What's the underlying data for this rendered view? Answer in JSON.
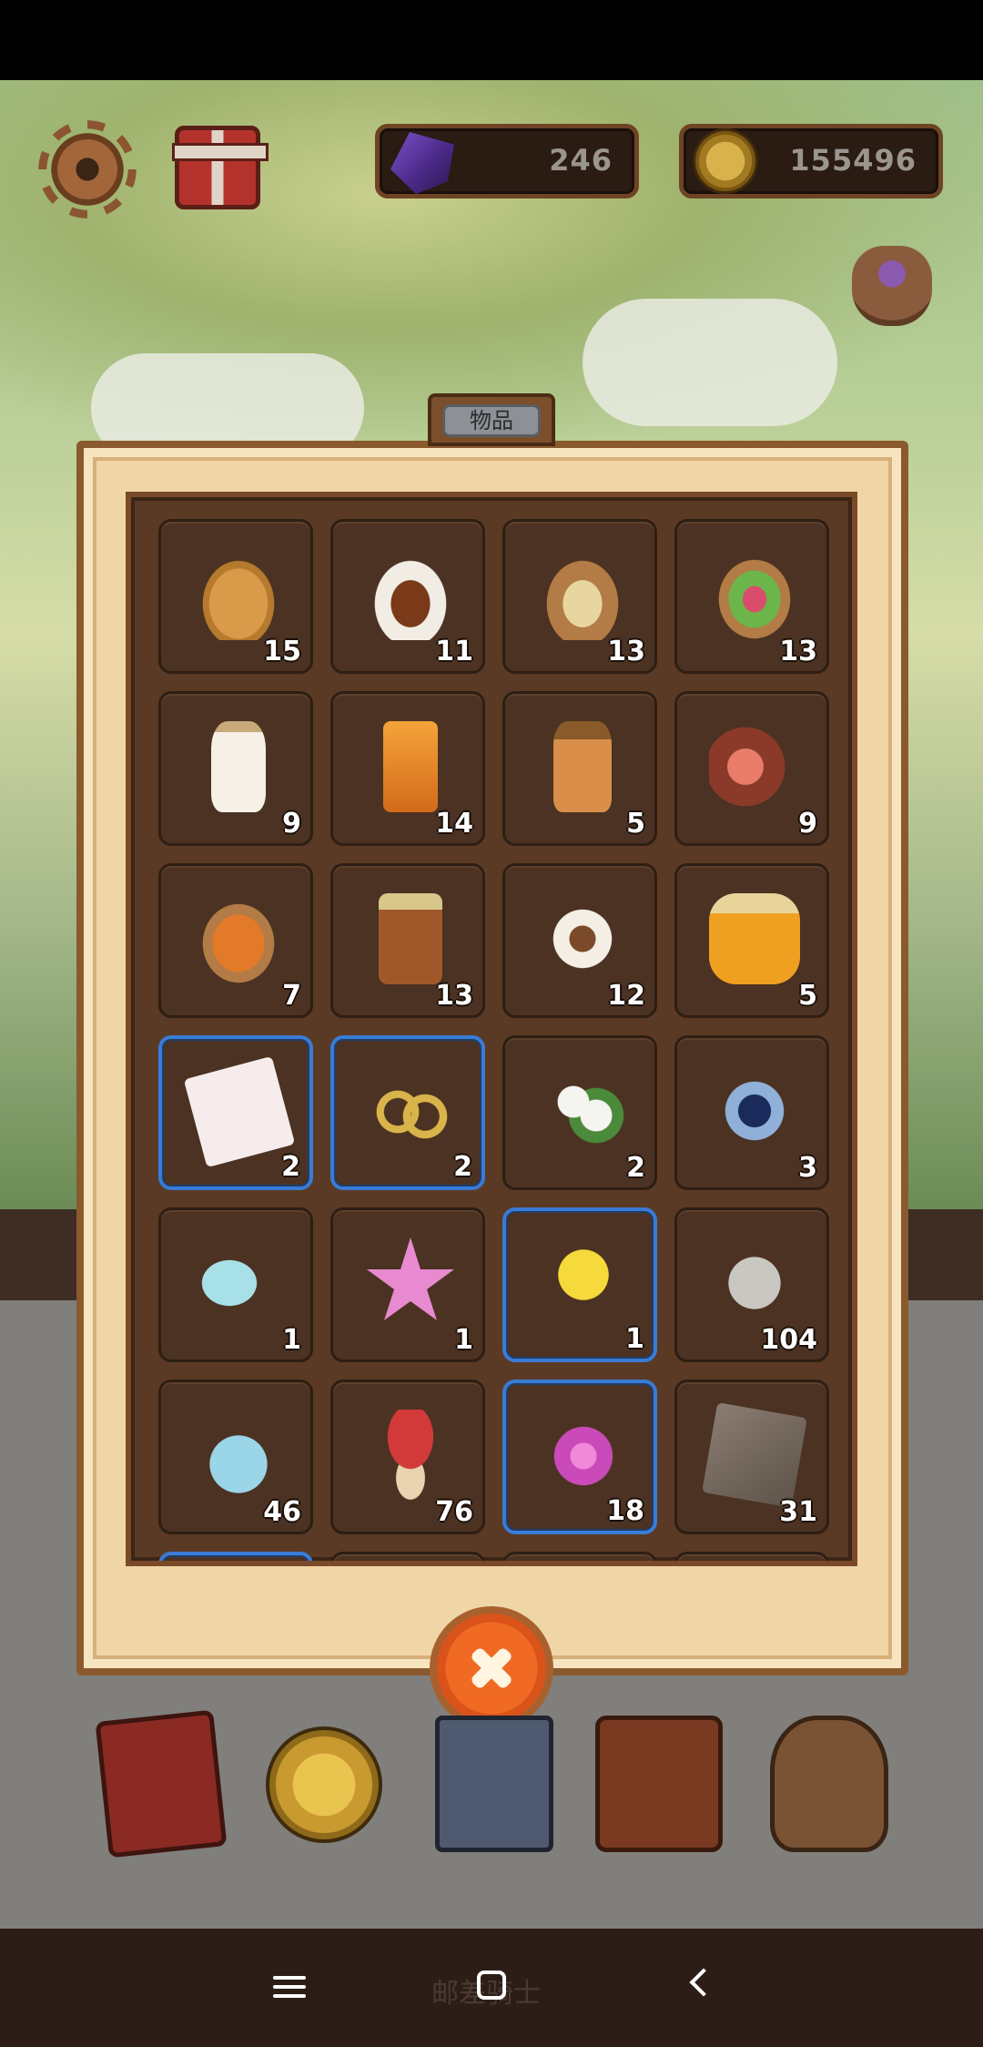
{
  "hud": {
    "gems": "246",
    "coins": "155496"
  },
  "panel": {
    "title": "物品",
    "items": [
      {
        "icon": "pancakes-icon",
        "count": "15",
        "selected": false
      },
      {
        "icon": "curry-rice-icon",
        "count": "11",
        "selected": false
      },
      {
        "icon": "soup-bowl-icon",
        "count": "13",
        "selected": false
      },
      {
        "icon": "salad-bowl-icon",
        "count": "13",
        "selected": false
      },
      {
        "icon": "milk-bottle-icon",
        "count": "9",
        "selected": false
      },
      {
        "icon": "juice-glass-icon",
        "count": "14",
        "selected": false
      },
      {
        "icon": "apple-cider-bottle-icon",
        "count": "5",
        "selected": false
      },
      {
        "icon": "ham-icon",
        "count": "9",
        "selected": false
      },
      {
        "icon": "grilled-fish-icon",
        "count": "7",
        "selected": false
      },
      {
        "icon": "beer-mug-icon",
        "count": "13",
        "selected": false
      },
      {
        "icon": "tea-cup-icon",
        "count": "12",
        "selected": false
      },
      {
        "icon": "honey-jar-icon",
        "count": "5",
        "selected": false
      },
      {
        "icon": "handkerchief-icon",
        "count": "2",
        "selected": true
      },
      {
        "icon": "gold-rings-icon",
        "count": "2",
        "selected": true
      },
      {
        "icon": "cotton-flower-icon",
        "count": "2",
        "selected": false
      },
      {
        "icon": "blue-leaf-icon",
        "count": "3",
        "selected": false
      },
      {
        "icon": "feather-wings-icon",
        "count": "1",
        "selected": false
      },
      {
        "icon": "pink-star-icon",
        "count": "1",
        "selected": false
      },
      {
        "icon": "yellow-puff-icon",
        "count": "1",
        "selected": true
      },
      {
        "icon": "animal-pelt-icon",
        "count": "104",
        "selected": false
      },
      {
        "icon": "potion-sack-icon",
        "count": "46",
        "selected": false
      },
      {
        "icon": "red-mushroom-icon",
        "count": "76",
        "selected": false
      },
      {
        "icon": "pink-shell-icon",
        "count": "18",
        "selected": true
      },
      {
        "icon": "stone-slab-icon",
        "count": "31",
        "selected": false
      }
    ]
  },
  "nav": {
    "faint_label": "邮差骑士"
  },
  "colors": {
    "panel_bg": "#f0d6a6",
    "grid_bg": "#5a3a24",
    "slot_bg": "#4b3222",
    "selected_border": "#3a7bd5",
    "close_button": "#f06a24"
  }
}
